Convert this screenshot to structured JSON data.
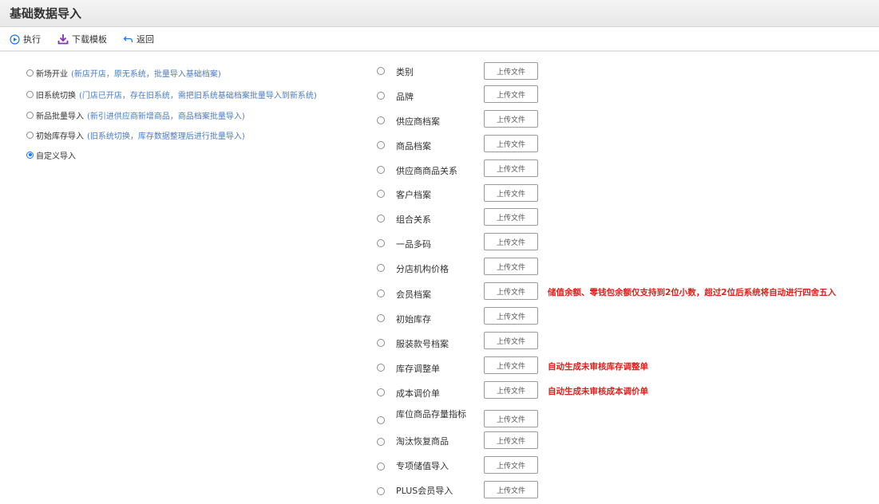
{
  "page": {
    "title": "基础数据导入"
  },
  "toolbar": {
    "execute_label": "执行",
    "download_label": "下载模板",
    "back_label": "返回",
    "accent_blue": "#1677ff",
    "accent_purple": "#8a2bb5"
  },
  "import_modes": [
    {
      "label": "新场开业",
      "desc": "(新店开店，原无系统，批量导入基础档案)",
      "checked": false
    },
    {
      "label": "旧系统切换",
      "desc": "(门店已开店，存在旧系统，需把旧系统基础档案批量导入到新系统)",
      "checked": false
    },
    {
      "label": "新品批量导入",
      "desc": "(新引进供应商新增商品，商品档案批量导入)",
      "checked": false
    },
    {
      "label": "初始库存导入",
      "desc": "(旧系统切换，库存数据整理后进行批量导入)",
      "checked": false
    },
    {
      "label": "自定义导入",
      "desc": "",
      "checked": true
    }
  ],
  "upload_button_label": "上传文件",
  "import_items": [
    {
      "label": "类别",
      "note": ""
    },
    {
      "label": "品牌",
      "note": ""
    },
    {
      "label": "供应商档案",
      "note": ""
    },
    {
      "label": "商品档案",
      "note": ""
    },
    {
      "label": "供应商商品关系",
      "note": ""
    },
    {
      "label": "客户档案",
      "note": ""
    },
    {
      "label": "组合关系",
      "note": ""
    },
    {
      "label": "一品多码",
      "note": ""
    },
    {
      "label": "分店机构价格",
      "note": ""
    },
    {
      "label": "会员档案",
      "note": "储值余额、零钱包余额仅支持到2位小数，超过2位后系统将自动进行四舍五入"
    },
    {
      "label": "初始库存",
      "note": ""
    },
    {
      "label": "服装款号档案",
      "note": ""
    },
    {
      "label": "库存调整单",
      "note": "自动生成未审核库存调整单"
    },
    {
      "label": "成本调价单",
      "note": "自动生成未审核成本调价单"
    },
    {
      "label": "库位商品存量指标",
      "note": ""
    },
    {
      "label": "淘汰恢复商品",
      "note": ""
    },
    {
      "label": "专项储值导入",
      "note": ""
    },
    {
      "label": "PLUS会员导入",
      "note": ""
    }
  ]
}
